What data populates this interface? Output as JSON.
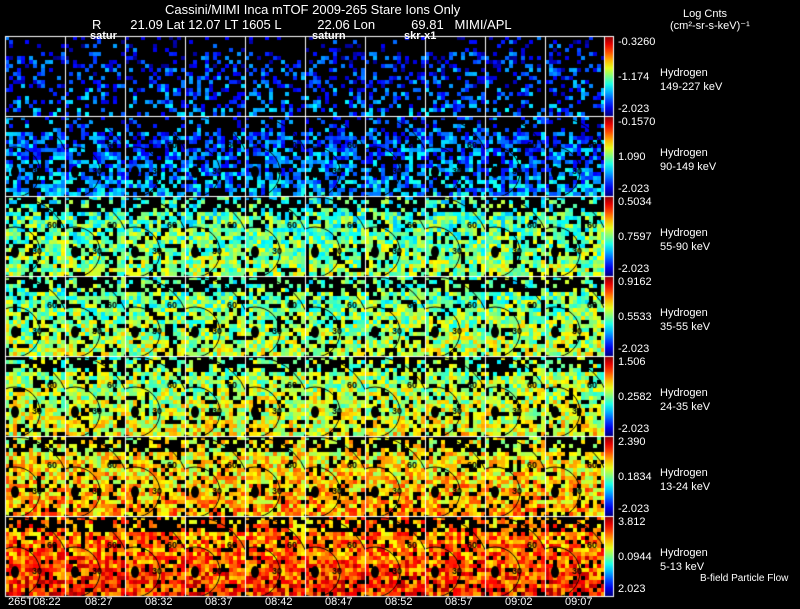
{
  "header": {
    "title": "Cassini/MIMI Inca mTOF  2009-265   Stare   Ions Only",
    "subtitle": "R        21.09 Lat 12.07 LT 1605 L          22.06 Lon          69.81   MIMI/APL",
    "units_line1": "Log Cnts",
    "units_line2": "(cm²-sr-s-keV)⁻¹",
    "overlay_labels": [
      "satur",
      "saturn",
      "skr-x1"
    ],
    "footer_note": "B-field Particle Flow"
  },
  "chart_data": {
    "type": "heatmap",
    "title": "Cassini/MIMI Inca mTOF  2009-265   Stare   Ions Only",
    "x_tick_labels": [
      "265T08:22",
      "08:27",
      "08:32",
      "08:37",
      "08:42",
      "08:47",
      "08:52",
      "08:57",
      "09:02",
      "09:07"
    ],
    "contour_labels": [
      "30",
      "60"
    ],
    "colorbar_label": "Log Cnts (cm²-sr-s-keV)⁻¹",
    "rows": [
      {
        "species": "Hydrogen",
        "energy": "149-227 keV",
        "cb_max": "-0.3260",
        "cb_mid": "-1.174",
        "cb_min": "-2.023"
      },
      {
        "species": "Hydrogen",
        "energy": "90-149 keV",
        "cb_max": "-0.1570",
        "cb_mid": "1.090",
        "cb_min": "-2.023"
      },
      {
        "species": "Hydrogen",
        "energy": "55-90 keV",
        "cb_max": "0.5034",
        "cb_mid": "0.7597",
        "cb_min": "-2.023"
      },
      {
        "species": "Hydrogen",
        "energy": "35-55 keV",
        "cb_max": "0.9162",
        "cb_mid": "0.5533",
        "cb_min": "-2.023"
      },
      {
        "species": "Hydrogen",
        "energy": "24-35 keV",
        "cb_max": "1.506",
        "cb_mid": "0.2582",
        "cb_min": "-2.023"
      },
      {
        "species": "Hydrogen",
        "energy": "13-24 keV",
        "cb_max": "2.390",
        "cb_mid": "0.1834",
        "cb_min": "-2.023"
      },
      {
        "species": "Hydrogen",
        "energy": "5-13 keV",
        "cb_max": "3.812",
        "cb_mid": "0.0944",
        "cb_min": "2.023"
      }
    ]
  }
}
